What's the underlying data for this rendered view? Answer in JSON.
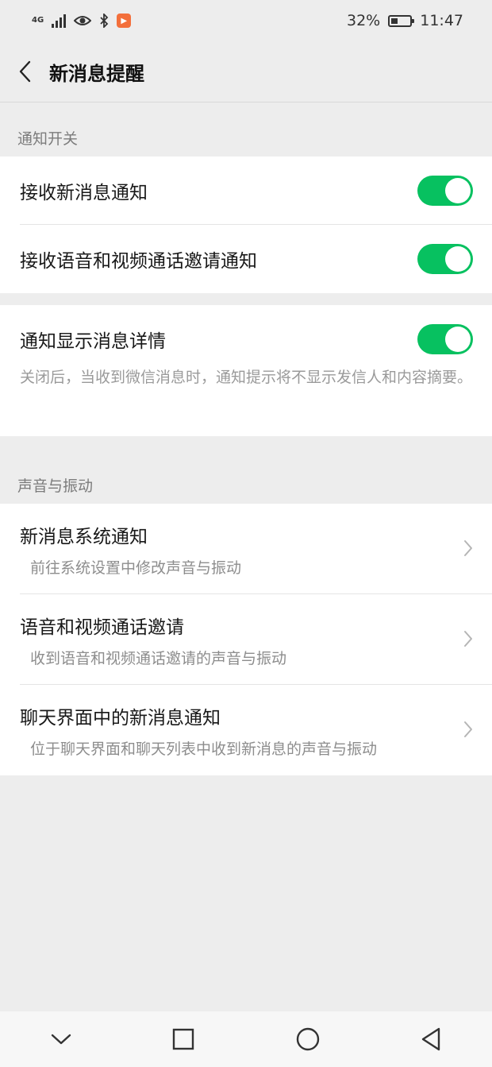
{
  "status_bar": {
    "network": "4G",
    "battery": "32%",
    "time": "11:47"
  },
  "header": {
    "title": "新消息提醒"
  },
  "sections": {
    "notification": {
      "header": "通知开关",
      "receive_new": {
        "label": "接收新消息通知",
        "on": true
      },
      "receive_call": {
        "label": "接收语音和视频通话邀请通知",
        "on": true
      },
      "show_detail": {
        "label": "通知显示消息详情",
        "on": true,
        "hint": "关闭后，当收到微信消息时，通知提示将不显示发信人和内容摘要。"
      }
    },
    "sound": {
      "header": "声音与振动",
      "items": [
        {
          "title": "新消息系统通知",
          "subtitle": "前往系统设置中修改声音与振动"
        },
        {
          "title": "语音和视频通话邀请",
          "subtitle": "收到语音和视频通话邀请的声音与振动"
        },
        {
          "title": "聊天界面中的新消息通知",
          "subtitle": "位于聊天界面和聊天列表中收到新消息的声音与振动"
        }
      ]
    }
  },
  "colors": {
    "accent": "#07c160",
    "background": "#ededed"
  }
}
